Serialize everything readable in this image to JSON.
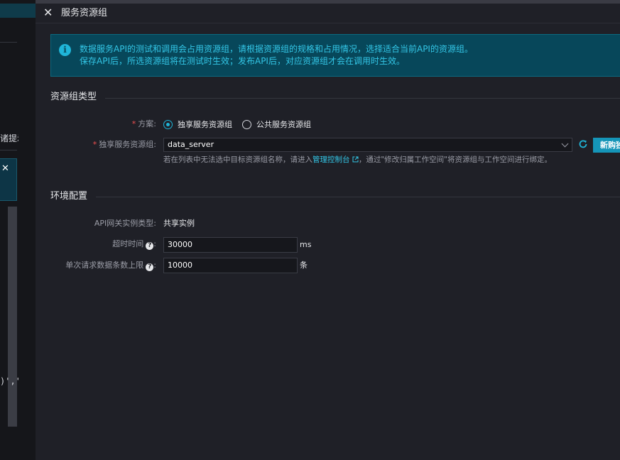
{
  "background": {
    "hint_text": "诸提示",
    "code_text": ")','"
  },
  "drawer": {
    "title": "服务资源组",
    "notice": {
      "line1": "数据服务API的测试和调用会占用资源组，请根据资源组的规格和占用情况，选择适合当前API的资源组。",
      "line2": "保存API后，所选资源组将在测试时生效；发布API后，对应资源组才会在调用时生效。"
    },
    "resource_group_section": {
      "title": "资源组类型",
      "scheme": {
        "label": "方案:",
        "options": [
          "独享服务资源组",
          "公共服务资源组"
        ],
        "selected": "独享服务资源组"
      },
      "exclusive_group": {
        "label": "独享服务资源组:",
        "value": "data_server",
        "new_button_label": "新购独享"
      },
      "helper": {
        "prefix": "若在列表中无法选中目标资源组名称，请进入",
        "link": "管理控制台",
        "suffix": "，通过\"修改归属工作空间\"将资源组与工作空间进行绑定。"
      }
    },
    "env_section": {
      "title": "环境配置",
      "gateway_type": {
        "label": "API网关实例类型:",
        "value": "共享实例"
      },
      "timeout": {
        "label": "超时时间",
        "value": "30000",
        "unit": "ms"
      },
      "max_rows": {
        "label": "单次请求数据条数上限",
        "value": "10000",
        "unit": "条"
      }
    }
  },
  "colors": {
    "accent": "#1fb5d8",
    "required": "#f05050",
    "button": "#1595b8"
  }
}
